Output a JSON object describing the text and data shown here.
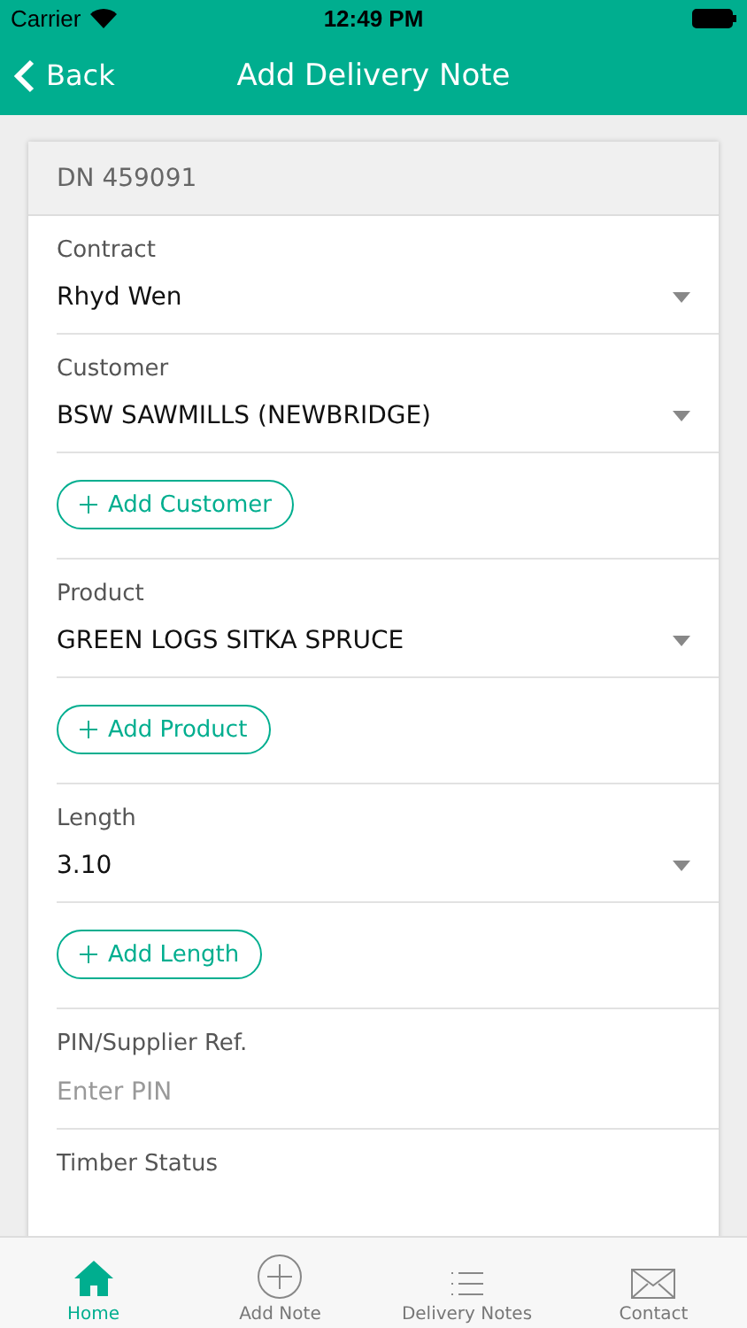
{
  "status_bar": {
    "carrier": "Carrier",
    "time": "12:49 PM"
  },
  "nav": {
    "back": "Back",
    "title": "Add Delivery Note"
  },
  "card": {
    "header": "DN 459091",
    "rows": [
      {
        "kind": "select",
        "label": "Contract",
        "value": "Rhyd Wen"
      },
      {
        "kind": "select",
        "label": "Customer",
        "value": "BSW SAWMILLS (NEWBRIDGE)"
      },
      {
        "kind": "add",
        "text": "Add Customer"
      },
      {
        "kind": "select",
        "label": "Product",
        "value": "GREEN LOGS SITKA SPRUCE"
      },
      {
        "kind": "add",
        "text": "Add Product"
      },
      {
        "kind": "select",
        "label": "Length",
        "value": "3.10"
      },
      {
        "kind": "add",
        "text": "Add Length"
      },
      {
        "kind": "input",
        "label": "PIN/Supplier Ref.",
        "placeholder": "Enter PIN"
      },
      {
        "kind": "label",
        "label": "Timber Status"
      }
    ]
  },
  "tabs": [
    {
      "kind": "home",
      "label": "Home",
      "selected": true
    },
    {
      "kind": "add",
      "label": "Add Note",
      "selected": false
    },
    {
      "kind": "list",
      "label": "Delivery Notes",
      "selected": false
    },
    {
      "kind": "mail",
      "label": "Contact",
      "selected": false
    }
  ]
}
